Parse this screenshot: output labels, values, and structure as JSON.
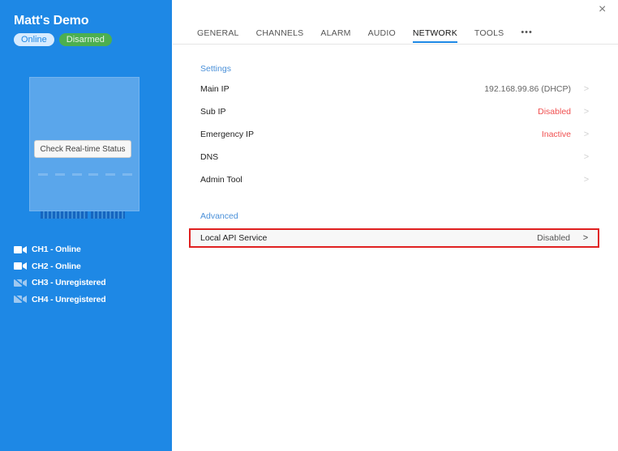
{
  "sidebar": {
    "device_name": "Matt's Demo",
    "badges": {
      "online": "Online",
      "disarmed": "Disarmed"
    },
    "realtime_button": "Check Real-time Status",
    "channels": [
      {
        "label": "CH1 - Online",
        "icon": "camera-icon"
      },
      {
        "label": "CH2 - Online",
        "icon": "camera-icon"
      },
      {
        "label": "CH3 - Unregistered",
        "icon": "camera-off-icon"
      },
      {
        "label": "CH4 - Unregistered",
        "icon": "camera-off-icon"
      }
    ]
  },
  "tabs": [
    {
      "label": "GENERAL"
    },
    {
      "label": "CHANNELS"
    },
    {
      "label": "ALARM"
    },
    {
      "label": "AUDIO"
    },
    {
      "label": "NETWORK",
      "active": true
    },
    {
      "label": "TOOLS"
    },
    {
      "label": "•••"
    }
  ],
  "close_icon": "×",
  "settings": {
    "title": "Settings",
    "rows": [
      {
        "label": "Main IP",
        "value": "192.168.99.86 (DHCP)"
      },
      {
        "label": "Sub IP",
        "value": "Disabled"
      },
      {
        "label": "Emergency IP",
        "value": "Inactive"
      },
      {
        "label": "DNS",
        "value": ""
      },
      {
        "label": "Admin Tool",
        "value": ""
      }
    ]
  },
  "advanced": {
    "title": "Advanced",
    "rows": [
      {
        "label": "Local API Service",
        "value": "Disabled"
      }
    ]
  },
  "colors": {
    "sidebar": "#1e88e5",
    "accent": "#1e88e5",
    "warning_red": "#f05050",
    "highlight_border": "#e02020"
  }
}
